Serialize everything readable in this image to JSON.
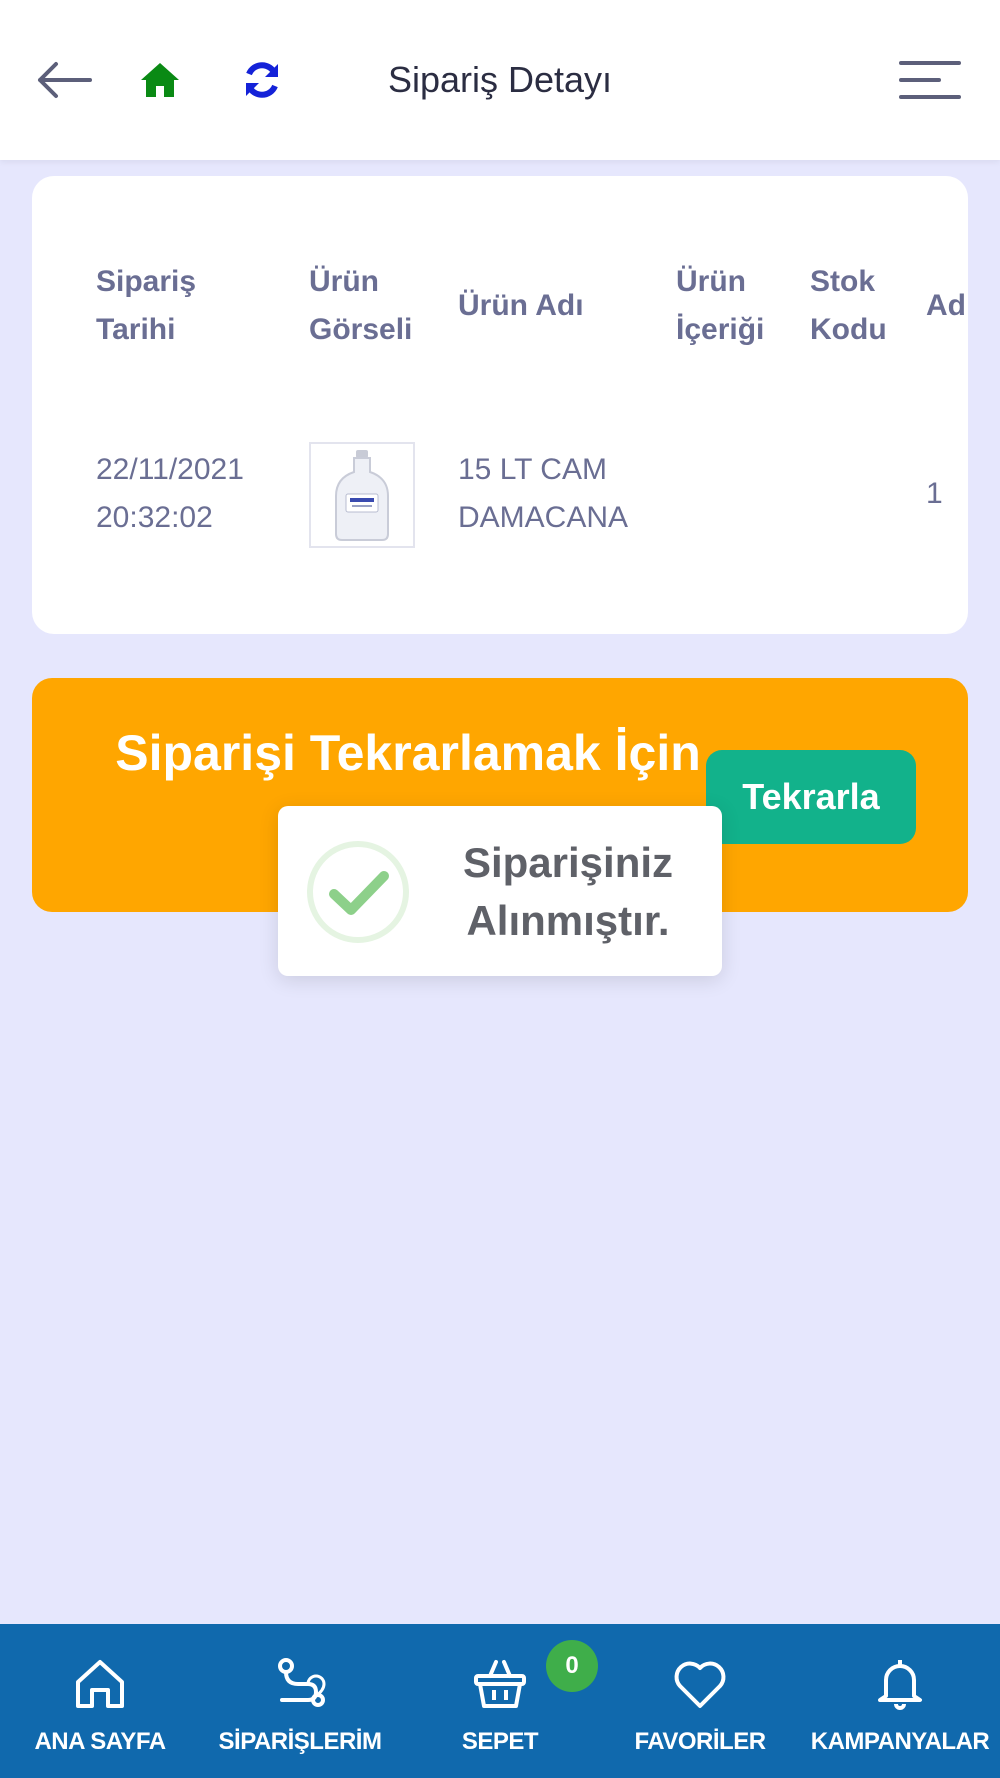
{
  "header": {
    "title": "Sipariş Detayı",
    "icons": {
      "back": "arrow-left-icon",
      "home": "home-icon",
      "refresh": "refresh-icon",
      "menu": "menu-icon"
    },
    "colors": {
      "home": "#0a8a14",
      "refresh": "#1422d8"
    }
  },
  "table": {
    "headers": {
      "order_date": [
        "Sipariş",
        "Tarihi"
      ],
      "product_image": [
        "Ürün",
        "Görseli"
      ],
      "product_name": "Ürün Adı",
      "product_content": [
        "Ürün",
        "İçeriği"
      ],
      "stock_code": [
        "Stok",
        "Kodu"
      ],
      "quantity": "Ad"
    },
    "rows": [
      {
        "order_date": [
          "22/11/2021",
          "20:32:02"
        ],
        "product_name": [
          "15 LT CAM",
          "DAMACANA"
        ],
        "product_content": "",
        "stock_code": "",
        "quantity": "1"
      }
    ]
  },
  "repeat": {
    "text": "Siparişi Tekrarlamak İçin",
    "button_label": "Tekrarla",
    "background": "#ffa600",
    "button_color": "#12b28b"
  },
  "toast": {
    "lines": [
      "Siparişiniz",
      "Alınmıştır."
    ],
    "icon": "check-circle-icon"
  },
  "bottom_nav": {
    "items": [
      {
        "label": "ANA SAYFA",
        "icon": "home-icon"
      },
      {
        "label": "SİPARİŞLERİM",
        "icon": "route-icon"
      },
      {
        "label": "SEPET",
        "icon": "basket-icon"
      },
      {
        "label": "FAVORİLER",
        "icon": "heart-icon"
      },
      {
        "label": "KAMPANYALAR",
        "icon": "bell-icon"
      }
    ],
    "cart_count": "0",
    "background": "#1069ad"
  }
}
